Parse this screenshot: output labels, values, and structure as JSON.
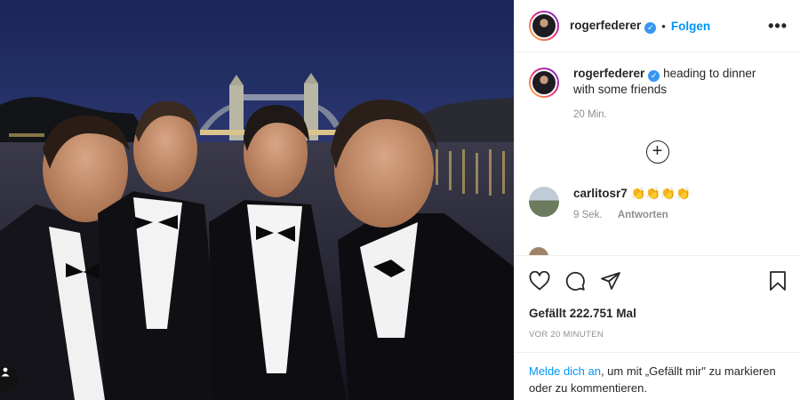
{
  "post": {
    "username": "rogerfederer",
    "follow_label": "Folgen",
    "more_label": "•••",
    "verified_glyph": "✓",
    "caption_text": "heading to dinner with some friends",
    "caption_time": "20 Min.",
    "load_more_glyph": "+",
    "comment": {
      "username": "carlitosr7",
      "text": "👏👏👏👏",
      "time": "9 Sek.",
      "reply_label": "Antworten"
    },
    "truncated_comment": "…",
    "likes_text": "Gefällt 222.751 Mal",
    "time_ago": "VOR 20 MINUTEN",
    "footer": {
      "login_link": "Melde dich an",
      "rest": ", um mit „Gefällt mir\" zu markieren oder zu kommentieren."
    }
  },
  "icons": {
    "like": "heart-icon",
    "comment": "comment-icon",
    "share": "paper-plane-icon",
    "save": "bookmark-icon",
    "add": "plus-circle-icon",
    "tag": "user-tag-icon"
  },
  "colors": {
    "link_blue": "#0095f6",
    "verified_blue": "#3897f0",
    "muted_gray": "#8e8e8e",
    "border": "#efefef"
  }
}
